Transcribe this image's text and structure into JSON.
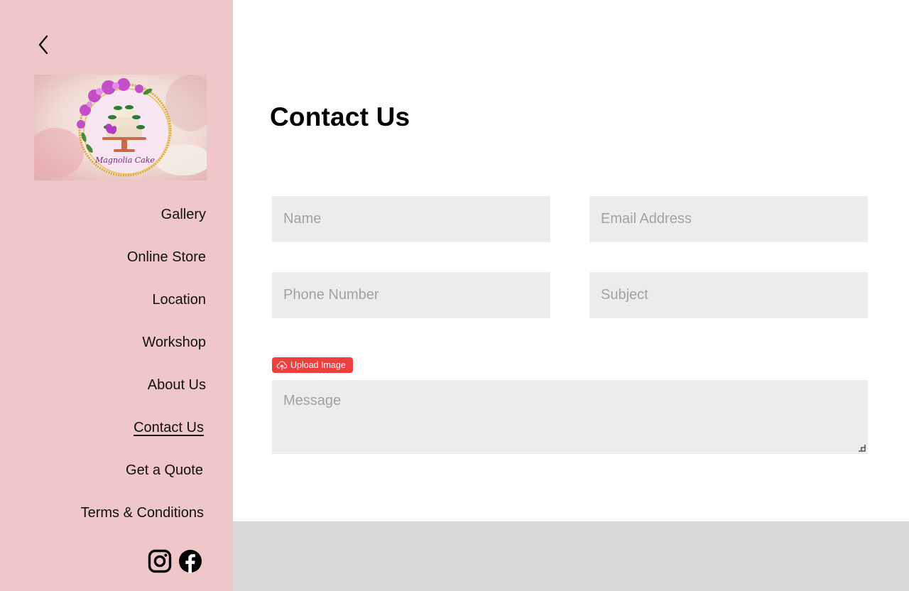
{
  "sidebar": {
    "nav": [
      {
        "label": "Gallery",
        "active": false
      },
      {
        "label": "Online Store",
        "active": false
      },
      {
        "label": "Location",
        "active": false
      },
      {
        "label": "Workshop",
        "active": false
      },
      {
        "label": "About Us",
        "active": false
      },
      {
        "label": "Contact Us",
        "active": true
      },
      {
        "label": "Get a Quote",
        "active": false
      },
      {
        "label": "Terms & Conditions",
        "active": false
      }
    ],
    "social": [
      "instagram-icon",
      "facebook-icon"
    ],
    "logo_text": "Magnolia Cake"
  },
  "main": {
    "title": "Contact Us",
    "form": {
      "name_placeholder": "Name",
      "email_placeholder": "Email Address",
      "phone_placeholder": "Phone Number",
      "subject_placeholder": "Subject",
      "upload_label": "Upload Image",
      "message_placeholder": "Message"
    }
  },
  "colors": {
    "sidebar_bg": "#efc7c8",
    "field_bg": "#ececec",
    "upload_button": "#ee3f3f",
    "footer_bg": "#d9d9d9"
  }
}
